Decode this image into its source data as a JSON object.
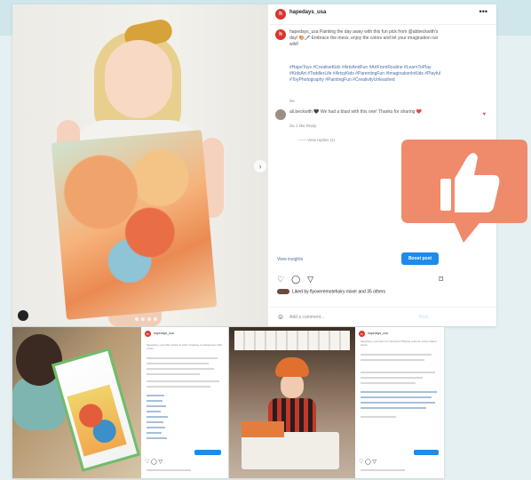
{
  "post": {
    "username": "hapedays_usa",
    "avatar_letter": "h",
    "more_label": "•••",
    "caption": "hapedays_usa Painting the day away with this fun pick from @abbeckwith's day! 🎨🖌️ Embrace the mess, enjoy the colors and let your imagination run wild!",
    "hashtags": "#HapeToys #CreativeKids #ArtsAndFun #ArtFromRoutine #LearnToPlay #KidsArt #ToddlerLife #ArtsyKids #ParentingFun #ImaginationInKids #Playful #ToyPhotography #PaintingFun #CreativityUnleashed",
    "post_age": "3w",
    "comment": {
      "text": "ali.beckwith 🖤 We had a blast with this one! Thanks for sharing ❤️",
      "meta": "2w   1 like   Reply",
      "view_replies": "—— View replies (1)"
    },
    "insights_label": "View insights",
    "boost_label": "Boost post",
    "likes_text": "Liked by flyoveremotehairy mixer and 35 others",
    "add_comment_placeholder": "Add a comment...",
    "post_button": "Post",
    "photo_next": "›"
  },
  "bottom_left": {
    "username": "hapedays_usa",
    "caption": "hapedays_usa Little artists at work! Creating a masterpiece with colors",
    "tags_count": "12"
  },
  "bottom_right": {
    "username": "hapedays_usa",
    "caption": "hapedays_usa Open for business! Playing pretend at the market stand"
  },
  "colors": {
    "brand_red": "#d9352c",
    "thumb_orange": "#ef8a6b",
    "boost_blue": "#1f8be8",
    "link_blue": "#4a6fa5"
  },
  "icons": [
    "heart-icon",
    "comment-icon",
    "share-icon",
    "bookmark-icon",
    "smile-icon",
    "thumbs-up-icon",
    "more-icon",
    "chevron-right-icon"
  ]
}
